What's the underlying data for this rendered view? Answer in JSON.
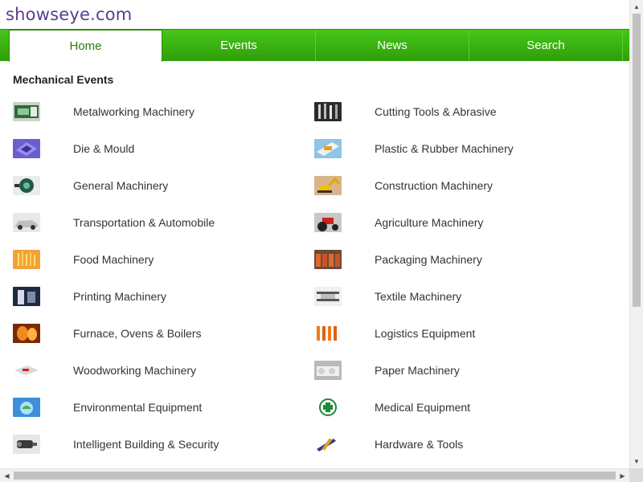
{
  "site": {
    "logo": "showseye.com"
  },
  "nav": [
    {
      "label": "Home",
      "active": true
    },
    {
      "label": "Events",
      "active": false
    },
    {
      "label": "News",
      "active": false
    },
    {
      "label": "Search",
      "active": false
    }
  ],
  "section": {
    "title": "Mechanical Events"
  },
  "rows": [
    [
      {
        "label": "Metalworking Machinery",
        "icon": "metalworking-thumbnail-icon"
      },
      {
        "label": "Cutting Tools & Abrasive",
        "icon": "cutting-tools-thumbnail-icon"
      }
    ],
    [
      {
        "label": "Die & Mould",
        "icon": "die-mould-thumbnail-icon"
      },
      {
        "label": "Plastic & Rubber Machinery",
        "icon": "plastic-rubber-thumbnail-icon"
      }
    ],
    [
      {
        "label": "General Machinery",
        "icon": "general-machinery-thumbnail-icon"
      },
      {
        "label": "Construction Machinery",
        "icon": "excavator-thumbnail-icon"
      }
    ],
    [
      {
        "label": "Transportation & Automobile",
        "icon": "car-thumbnail-icon"
      },
      {
        "label": "Agriculture Machinery",
        "icon": "tractor-thumbnail-icon"
      }
    ],
    [
      {
        "label": "Food Machinery",
        "icon": "fries-thumbnail-icon"
      },
      {
        "label": "Packaging Machinery",
        "icon": "packaging-thumbnail-icon"
      }
    ],
    [
      {
        "label": "Printing Machinery",
        "icon": "printing-thumbnail-icon"
      },
      {
        "label": "Textile Machinery",
        "icon": "textile-thumbnail-icon"
      }
    ],
    [
      {
        "label": "Furnace, Ovens & Boilers",
        "icon": "furnace-thumbnail-icon"
      },
      {
        "label": "Logistics Equipment",
        "icon": "logistics-thumbnail-icon"
      }
    ],
    [
      {
        "label": "Woodworking Machinery",
        "icon": "woodworking-thumbnail-icon"
      },
      {
        "label": "Paper Machinery",
        "icon": "paper-thumbnail-icon"
      }
    ],
    [
      {
        "label": "Environmental Equipment",
        "icon": "environment-thumbnail-icon"
      },
      {
        "label": "Medical Equipment",
        "icon": "medical-cross-thumbnail-icon"
      }
    ],
    [
      {
        "label": "Intelligent Building & Security",
        "icon": "security-camera-thumbnail-icon"
      },
      {
        "label": "Hardware & Tools",
        "icon": "hardware-tools-thumbnail-icon"
      }
    ]
  ],
  "colors": {
    "nav_green": "#3bb512",
    "logo_purple": "#5a3d8f",
    "active_tab_text": "#2d7a08"
  }
}
